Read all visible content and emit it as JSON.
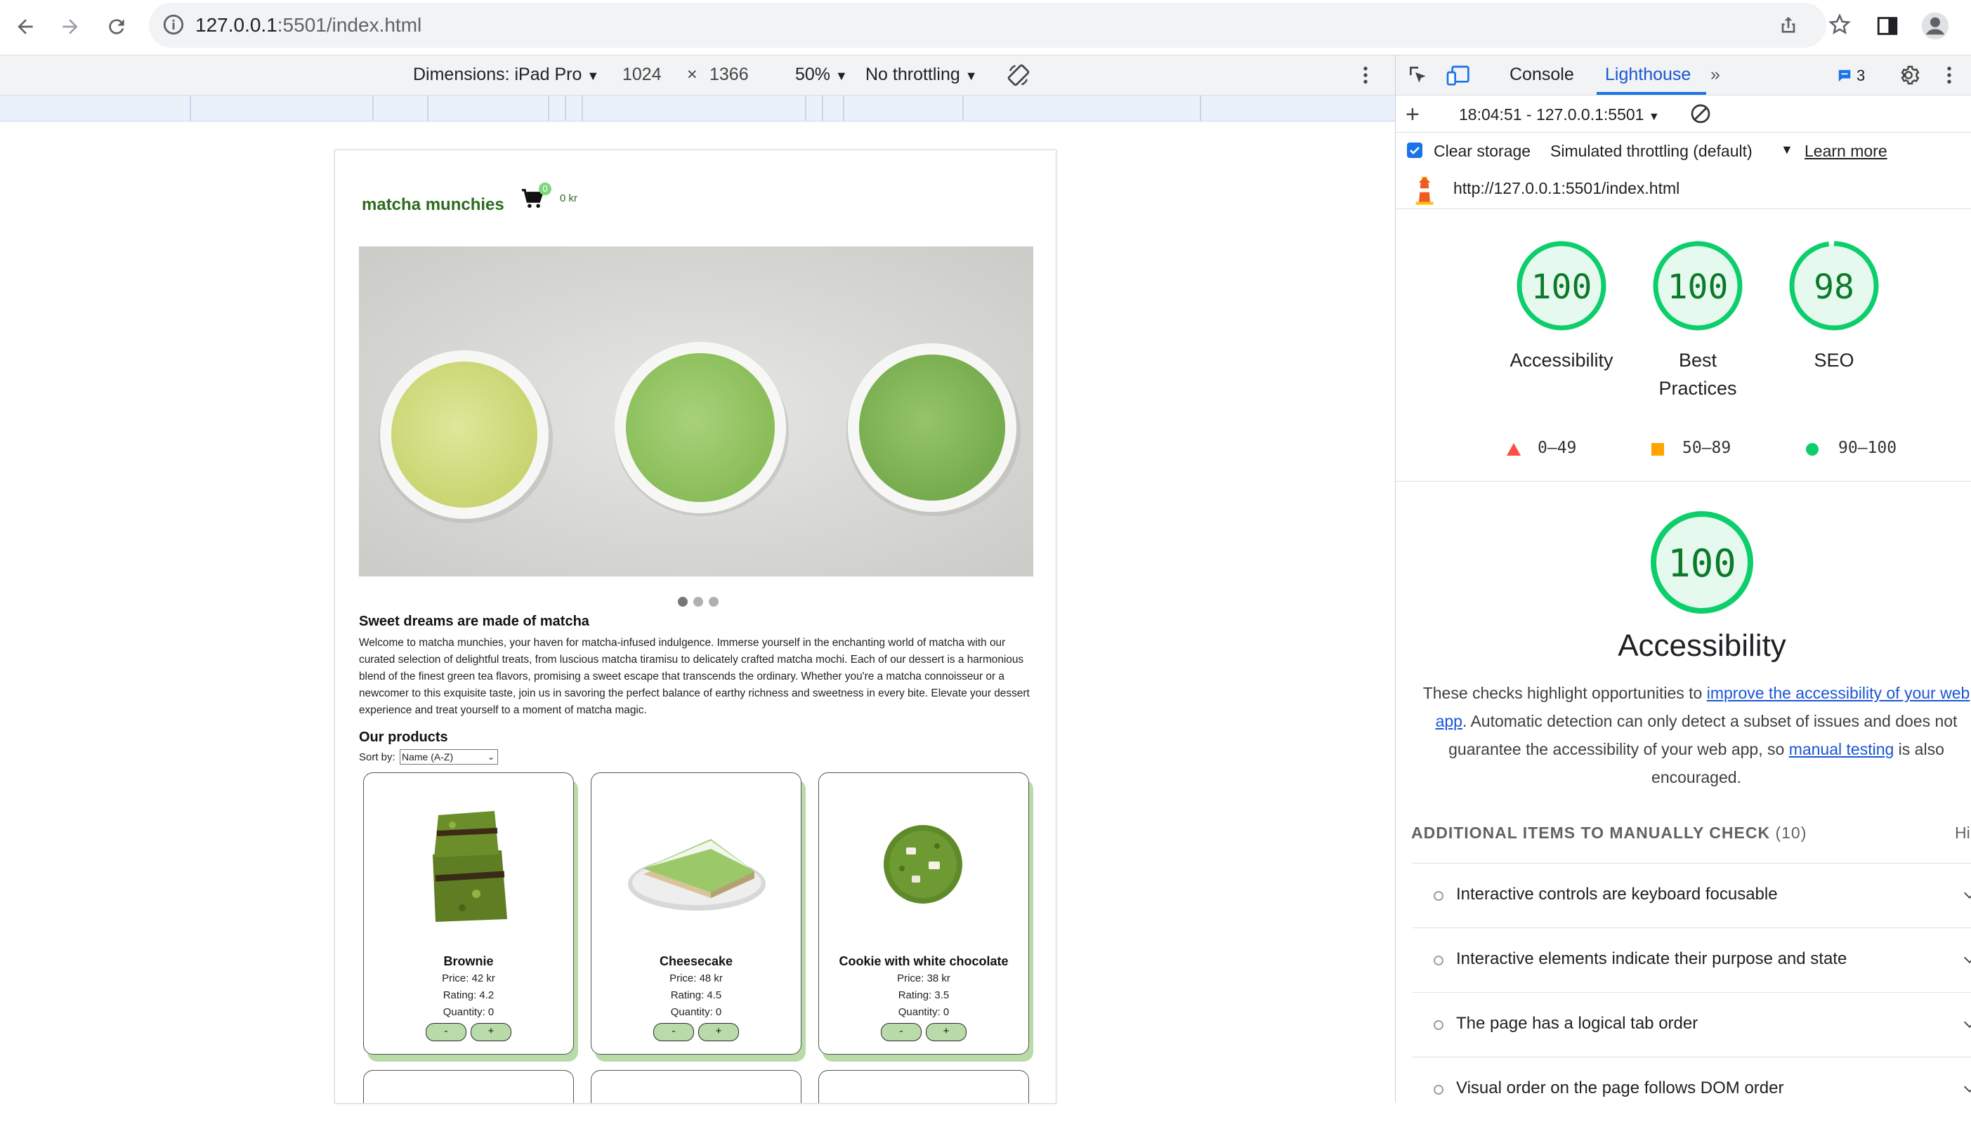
{
  "browser": {
    "url_host": "127.0.0.1",
    "url_path": ":5501/index.html"
  },
  "device_toolbar": {
    "dimensions_label": "Dimensions: iPad Pro",
    "width": "1024",
    "times": "×",
    "height": "1366",
    "zoom": "50%",
    "throttling": "No throttling"
  },
  "site": {
    "brand": "matcha munchies",
    "cart_count": "0",
    "cart_total": "0 kr",
    "hero_title": "Sweet dreams are made of matcha",
    "hero_text": "Welcome to matcha munchies, your haven for matcha-infused indulgence. Immerse yourself in the enchanting world of matcha with our curated selection of delightful treats, from luscious matcha tiramisu to delicately crafted matcha mochi. Each of our dessert is a harmonious blend of the finest green tea flavors, promising a sweet escape that transcends the ordinary. Whether you're a matcha connoisseur or a newcomer to this exquisite taste, join us in savoring the perfect balance of earthy richness and sweetness in every bite. Elevate your dessert experience and treat yourself to a moment of matcha magic.",
    "products_title": "Our products",
    "sort_label": "Sort by:",
    "sort_value": "Name (A-Z)",
    "products": [
      {
        "name": "Brownie",
        "price": "Price: 42 kr",
        "rating": "Rating: 4.2",
        "quantity": "Quantity: 0",
        "minus": "-",
        "plus": "+"
      },
      {
        "name": "Cheesecake",
        "price": "Price: 48 kr",
        "rating": "Rating: 4.5",
        "quantity": "Quantity: 0",
        "minus": "-",
        "plus": "+"
      },
      {
        "name": "Cookie with white chocolate",
        "price": "Price: 38 kr",
        "rating": "Rating: 3.5",
        "quantity": "Quantity: 0",
        "minus": "-",
        "plus": "+"
      }
    ]
  },
  "devtools": {
    "tabs": [
      "Console",
      "Lighthouse"
    ],
    "issues_count": "3",
    "report_selector": "18:04:51 - 127.0.0.1:5501",
    "clear_storage": "Clear storage",
    "throttling_mode": "Simulated throttling (default)",
    "learn_more": "Learn more",
    "audited_url": "http://127.0.0.1:5501/index.html",
    "scores": [
      {
        "label": "Accessibility",
        "value": "100"
      },
      {
        "label": "Best Practices",
        "value": "100"
      },
      {
        "label": "SEO",
        "value": "98"
      }
    ],
    "legend": [
      "0–49",
      "50–89",
      "90–100"
    ],
    "detail_score": "100",
    "detail_title": "Accessibility",
    "desc_1": "These checks highlight opportunities to ",
    "desc_link_1": "improve the accessibility of your web app",
    "desc_2": ". Automatic detection can only detect a subset of issues and does not guarantee the accessibility of your web app, so ",
    "desc_link_2": "manual testing",
    "desc_3": " is also encouraged.",
    "manual_header": "ADDITIONAL ITEMS TO MANUALLY CHECK",
    "manual_count": "(10)",
    "hide_label": "Hi",
    "manual_items": [
      "Interactive controls are keyboard focusable",
      "Interactive elements indicate their purpose and state",
      "The page has a logical tab order",
      "Visual order on the page follows DOM order"
    ],
    "colors": {
      "pass": "#0cce6b",
      "average": "#ffa400",
      "fail": "#ff4e42",
      "accent": "#1a73e8"
    }
  }
}
